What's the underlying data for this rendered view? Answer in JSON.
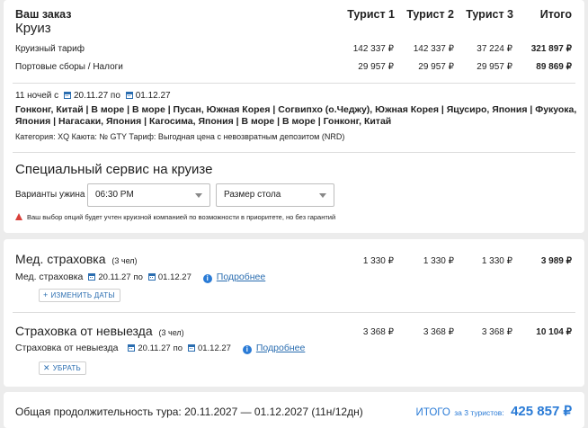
{
  "order": {
    "title": "Ваш заказ",
    "subtitle": "Круиз",
    "columns": [
      "Турист 1",
      "Турист 2",
      "Турист 3",
      "Итого"
    ],
    "rows": [
      {
        "label": "Круизный тариф",
        "values": [
          "142 337 ₽",
          "142 337 ₽",
          "37 224 ₽",
          "321 897 ₽"
        ]
      },
      {
        "label": "Портовые сборы / Налоги",
        "values": [
          "29 957 ₽",
          "29 957 ₽",
          "29 957 ₽",
          "89 869 ₽"
        ]
      }
    ],
    "nights_prefix": "11 ночей с",
    "date_from": "20.11.27",
    "date_to_prefix": "по",
    "date_to": "01.12.27",
    "route_line1": "Гонконг, Китай | В море | В море | Пусан, Южная Корея | Согвипхо (о.Чеджу), Южная Корея | Яцусиро, Япония | Фукуока,",
    "route_line2": "Япония | Нагасаки, Япония | Кагосима, Япония | В море | В море | Гонконг, Китай",
    "category": "Категория: XQ  Каюта: № GTY  Тариф: Выгодная цена с невозвратным депозитом (NRD)"
  },
  "special": {
    "title": "Специальный сервис на круизе",
    "dinner_label": "Варианты ужина",
    "dinner_value": "06:30 PM",
    "table_value": "Размер стола",
    "warning": "Ваш выбор опций будет учтен круизной компанией по возможности в приоритете, но без гарантий"
  },
  "med": {
    "title": "Мед. страховка",
    "count": "(3 чел)",
    "values": [
      "1 330 ₽",
      "1 330 ₽",
      "1 330 ₽",
      "3 989 ₽"
    ],
    "item_label": "Мед. страховка",
    "date_from": "20.11.27",
    "date_to_prefix": "по",
    "date_to": "01.12.27",
    "details": "Подробнее",
    "button": "ИЗМЕНИТЬ ДАТЫ",
    "button_symbol": "+"
  },
  "cancel": {
    "title": "Страховка от невыезда",
    "count": "(3 чел)",
    "values": [
      "3 368 ₽",
      "3 368 ₽",
      "3 368 ₽",
      "10 104 ₽"
    ],
    "item_label": "Страховка от невыезда",
    "date_from": "20.11.27",
    "date_to_prefix": "по",
    "date_to": "01.12.27",
    "details": "Подробнее",
    "button": "УБРАТЬ",
    "button_symbol": "✕"
  },
  "footer": {
    "duration": "Общая продолжительность тура: 20.11.2027 — 01.12.2027 (11н/12дн)",
    "total_label": "ИТОГО",
    "total_for": "за 3 туристов:",
    "total_value": "425 857 ₽"
  },
  "colors": {
    "accent": "#2a6db0",
    "total": "#2a7bd6",
    "warning": "#d9403a"
  }
}
